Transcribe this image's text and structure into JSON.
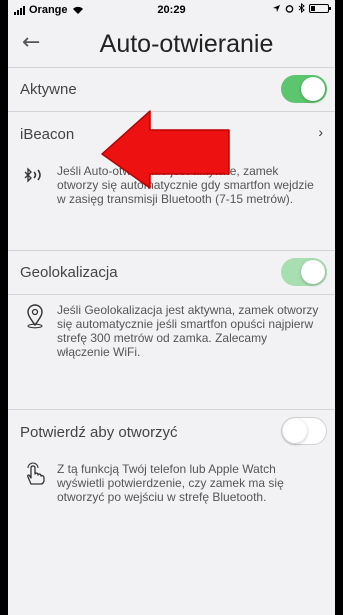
{
  "status": {
    "carrier": "Orange",
    "time": "20:29"
  },
  "header": {
    "title": "Auto-otwieranie"
  },
  "rows": {
    "aktywne": {
      "label": "Aktywne"
    },
    "ibeacon": {
      "label": "iBeacon"
    },
    "geo": {
      "label": "Geolokalizacja"
    },
    "confirm": {
      "label": "Potwierdź aby otworzyć"
    }
  },
  "info": {
    "ibeacon": "Jeśli Auto-otwieranie jest aktywne, zamek otworzy się automatycznie gdy smartfon wejdzie w zasięg transmisji Bluetooth (7-15 metrów).",
    "geo": "Jeśli Geolokalizacja jest aktywna, zamek otworzy się automatycznie jeśli smartfon opuści najpierw strefę 300 metrów od zamka. Zalecamy włączenie WiFi.",
    "confirm": "Z tą funkcją Twój telefon lub Apple Watch wyświetli potwierdzenie, czy zamek ma się otworzyć po wejściu w strefę Bluetooth."
  },
  "toggles": {
    "aktywne": true,
    "geo": true,
    "confirm": false
  },
  "colors": {
    "toggle_on": "#5bc66d",
    "arrow": "#ee1111"
  },
  "icons": [
    "bluetooth-icon",
    "location-pin-icon",
    "hand-tap-icon",
    "chevron-right-icon",
    "back-arrow-icon"
  ]
}
